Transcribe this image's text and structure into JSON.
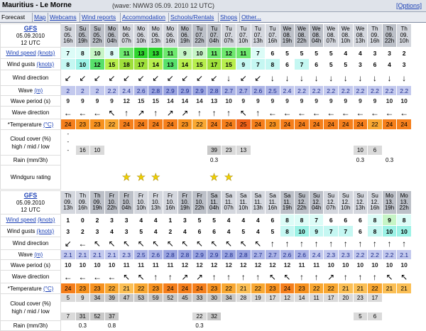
{
  "header": {
    "title": "Mauritius - Le Morne",
    "wave_info": "(wave: NWW3 05.09. 2010 12 UTC)",
    "options": "[Options]"
  },
  "tabs": [
    "Forecast",
    "Map",
    "Webcams",
    "Wind reports",
    "Accommodation",
    "Schools/Rentals",
    "Shops",
    "Other..."
  ],
  "labels": {
    "wind_speed": "Wind speed",
    "knots": "(knots)",
    "wind_gusts": "Wind gusts",
    "wind_direction": "Wind direction",
    "wave": "Wave",
    "wave_unit": "(m)",
    "wave_period": "Wave period (s)",
    "wave_direction": "Wave direction",
    "temperature": "*Temperature",
    "temp_unit": "(°C)",
    "cloud1": "Cloud cover (%)",
    "cloud2": "high / mid / low",
    "rain": "Rain (mm/3h)",
    "rating": "Windguru rating"
  },
  "colors": {
    "wind_low": "#ffffff",
    "wind_mid": "#bff5f0",
    "wind_high": "#3fe23f",
    "wind_gust_high": "#a8f030",
    "wave": "#aab2e6",
    "temp": "#f28c1a"
  },
  "blocks": [
    {
      "model": "GFS",
      "date": "05.09.2010",
      "run": "12 UTC",
      "days": [
        "Su",
        "Su",
        "Su",
        "Mo",
        "Mo",
        "Mo",
        "Mo",
        "Mo",
        "Mo",
        "Tu",
        "Tu",
        "Tu",
        "Tu",
        "Tu",
        "Tu",
        "We",
        "We",
        "We",
        "We",
        "We",
        "We",
        "Th",
        "Th",
        "Th"
      ],
      "dates": [
        "05.",
        "05.",
        "05.",
        "06.",
        "06.",
        "06.",
        "06.",
        "06.",
        "06.",
        "07.",
        "07.",
        "07.",
        "07.",
        "07.",
        "07.",
        "08.",
        "08.",
        "08.",
        "08.",
        "08.",
        "08.",
        "09.",
        "09.",
        "09."
      ],
      "hours": [
        "16h",
        "19h",
        "22h",
        "04h",
        "07h",
        "10h",
        "13h",
        "16h",
        "19h",
        "22h",
        "04h",
        "07h",
        "10h",
        "13h",
        "16h",
        "19h",
        "22h",
        "04h",
        "07h",
        "10h",
        "13h",
        "16h",
        "22h",
        "10h"
      ],
      "wind": [
        7,
        8,
        10,
        8,
        11,
        13,
        13,
        11,
        9,
        10,
        11,
        12,
        11,
        7,
        6,
        5,
        5,
        5,
        5,
        4,
        4,
        3,
        3,
        2
      ],
      "gusts": [
        8,
        10,
        12,
        15,
        18,
        17,
        14,
        13,
        14,
        15,
        17,
        15,
        9,
        7,
        8,
        6,
        7,
        6,
        5,
        5,
        3,
        6,
        4,
        3
      ],
      "wdir": [
        "↙",
        "↙",
        "↙",
        "↙",
        "↙",
        "↙",
        "↙",
        "↙",
        "↙",
        "↙",
        "↙",
        "↓",
        "↙",
        "↙",
        "↓",
        "↓",
        "↓",
        "↓",
        "↓",
        "↓",
        "↓",
        "↓",
        "↓",
        "↓"
      ],
      "wave": [
        "2",
        "2",
        "2",
        "2.2",
        "2.4",
        "2.6",
        "2.8",
        "2.9",
        "2.9",
        "2.9",
        "2.8",
        "2.7",
        "2.7",
        "2.6",
        "2.5",
        "2.4",
        "2.2",
        "2.2",
        "2.2",
        "2.2",
        "2.2",
        "2.2",
        "2.2",
        "2.2"
      ],
      "period": [
        9,
        9,
        9,
        9,
        12,
        15,
        15,
        14,
        14,
        14,
        13,
        10,
        9,
        9,
        9,
        9,
        9,
        9,
        9,
        9,
        9,
        9,
        10,
        10
      ],
      "wvdir": [
        "←",
        "←",
        "←",
        "↖",
        "↑",
        "↗",
        "↑",
        "↗",
        "↗",
        "↑",
        "↑",
        "↑",
        "↖",
        "↑",
        "←",
        "←",
        "←",
        "←",
        "←",
        "←",
        "←",
        "←",
        "←",
        "←"
      ],
      "temp": [
        24,
        23,
        23,
        22,
        24,
        24,
        24,
        24,
        23,
        22,
        24,
        24,
        25,
        24,
        23,
        24,
        24,
        24,
        24,
        24,
        24,
        22,
        24,
        24
      ],
      "cloud_top": [
        "-",
        "",
        "",
        "",
        "",
        "",
        "",
        "",
        "",
        "",
        "",
        "",
        "",
        "",
        "",
        "",
        "",
        "",
        "",
        "",
        "",
        "",
        "",
        ""
      ],
      "cloud_mid": [
        "-",
        "",
        "",
        "",
        "",
        "",
        "",
        "",
        "",
        "",
        "",
        "",
        "",
        "",
        "",
        "",
        "",
        "",
        "",
        "",
        "",
        "",
        "",
        ""
      ],
      "cloud_low": [
        "-",
        "16",
        "10",
        "",
        "",
        "",
        "",
        "",
        "",
        "",
        "39",
        "23",
        "13",
        "",
        "",
        "",
        "",
        "",
        "",
        "",
        "10",
        "6",
        "",
        ""
      ],
      "rain": [
        "",
        "",
        "",
        "",
        "",
        "",
        "",
        "",
        "",
        "",
        "0.3",
        "",
        "",
        "",
        "",
        "",
        "",
        "",
        "",
        "",
        "0.3",
        "",
        "0.3",
        ""
      ],
      "stars": [
        "",
        "",
        "",
        "",
        "★",
        "★",
        "★",
        "",
        "",
        "",
        "★",
        "★",
        "",
        "",
        "",
        "",
        "",
        "",
        "",
        "",
        "",
        "",
        "",
        ""
      ]
    },
    {
      "model": "GFS",
      "date": "05.09.2010",
      "run": "12 UTC",
      "days": [
        "Th",
        "Th",
        "Th",
        "Fr",
        "Fr",
        "Fr",
        "Fr",
        "Fr",
        "Fr",
        "Fr",
        "Sa",
        "Sa",
        "Sa",
        "Sa",
        "Sa",
        "Sa",
        "Su",
        "Su",
        "Su",
        "Su",
        "Su",
        "Su",
        "Mo",
        "Mo"
      ],
      "dates": [
        "09.",
        "09.",
        "09.",
        "10.",
        "10.",
        "10.",
        "10.",
        "10.",
        "10.",
        "10.",
        "11.",
        "11.",
        "11.",
        "11.",
        "11.",
        "11.",
        "12.",
        "12.",
        "12.",
        "12.",
        "12.",
        "12.",
        "13.",
        "13."
      ],
      "hours": [
        "13h",
        "16h",
        "19h",
        "22h",
        "04h",
        "10h",
        "13h",
        "16h",
        "19h",
        "22h",
        "04h",
        "07h",
        "10h",
        "13h",
        "16h",
        "19h",
        "22h",
        "04h",
        "07h",
        "10h",
        "13h",
        "16h",
        "19h",
        "22h"
      ],
      "wind": [
        1,
        0,
        2,
        3,
        3,
        4,
        4,
        1,
        3,
        5,
        5,
        4,
        4,
        4,
        6,
        8,
        8,
        7,
        6,
        6,
        6,
        8,
        9,
        8
      ],
      "gusts": [
        3,
        2,
        3,
        4,
        3,
        5,
        4,
        2,
        4,
        6,
        6,
        4,
        5,
        4,
        5,
        8,
        10,
        9,
        7,
        7,
        6,
        8,
        10,
        10
      ],
      "wdir": [
        "↙",
        "←",
        "↖",
        "↖",
        "↖",
        "↖",
        "↖",
        "↖",
        "↖",
        "↖",
        "↖",
        "↖",
        "↖",
        "↖",
        "↑",
        "↑",
        "↑",
        "↑",
        "↑",
        "↑",
        "↑",
        "↑",
        "↑",
        "↑"
      ],
      "wave": [
        "2.1",
        "2.1",
        "2.1",
        "2.1",
        "2.3",
        "2.5",
        "2.6",
        "2.8",
        "2.8",
        "2.9",
        "2.9",
        "2.8",
        "2.8",
        "2.7",
        "2.7",
        "2.6",
        "2.6",
        "2.4",
        "2.3",
        "2.3",
        "2.2",
        "2.2",
        "2.2",
        "2.1"
      ],
      "period": [
        10,
        10,
        10,
        10,
        11,
        11,
        11,
        11,
        12,
        12,
        12,
        12,
        12,
        12,
        12,
        12,
        11,
        11,
        10,
        10,
        10,
        10,
        10,
        10
      ],
      "wvdir": [
        "←",
        "←",
        "←",
        "←",
        "↖",
        "↖",
        "↑",
        "↑",
        "↗",
        "↗",
        "↑",
        "↑",
        "↑",
        "↑",
        "↖",
        "↖",
        "↑",
        "↑",
        "↗",
        "↑",
        "↑",
        "↑",
        "↖",
        "↖"
      ],
      "temp": [
        24,
        23,
        23,
        22,
        21,
        22,
        23,
        24,
        24,
        24,
        23,
        22,
        21,
        22,
        23,
        24,
        23,
        22,
        22,
        21,
        21,
        22,
        21,
        21
      ],
      "cloud_top": [
        "5",
        "9",
        "34",
        "39",
        "47",
        "53",
        "59",
        "52",
        "45",
        "33",
        "30",
        "34",
        "28",
        "19",
        "17",
        "12",
        "14",
        "11",
        "17",
        "20",
        "23",
        "17",
        "",
        ""
      ],
      "cloud_mid": [
        "",
        "",
        "",
        "",
        "",
        "",
        "",
        "",
        "",
        "",
        "",
        "",
        "",
        "",
        "",
        "",
        "",
        "",
        "",
        "",
        "",
        "",
        "",
        ""
      ],
      "cloud_low": [
        "7",
        "31",
        "52",
        "37",
        "",
        "",
        "",
        "",
        "",
        "22",
        "32",
        "",
        "",
        "",
        "",
        "",
        "",
        "",
        "",
        "",
        "5",
        "6",
        "",
        ""
      ],
      "rain": [
        "",
        "0.3",
        "",
        "0.8",
        "",
        "",
        "",
        "",
        "",
        "0.3",
        "",
        "",
        "",
        "",
        "",
        "",
        "",
        "",
        "",
        "",
        "",
        "",
        "",
        ""
      ]
    }
  ]
}
